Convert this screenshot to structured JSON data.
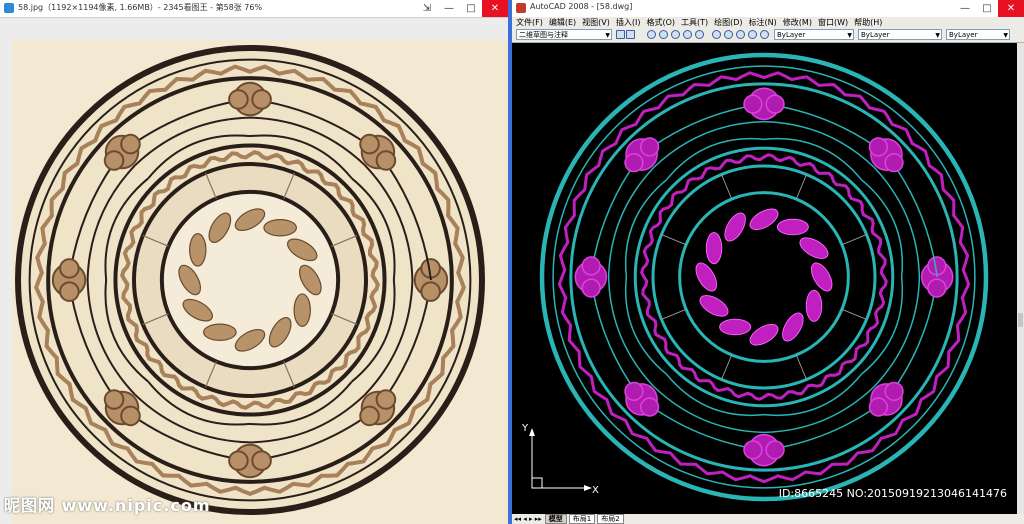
{
  "left_window": {
    "title": "58.jpg（1192×1194像素, 1.66MB）- 2345看图王 - 第58张 76%",
    "buttons": {
      "pin": "⇲",
      "min": "—",
      "max": "□",
      "close": "✕"
    },
    "watermark": "昵图网 www.nipic.com"
  },
  "right_window": {
    "title": "AutoCAD 2008 - [58.dwg]",
    "buttons": {
      "min": "—",
      "max": "□",
      "close": "✕"
    },
    "menu": [
      "文件(F)",
      "编辑(E)",
      "视图(V)",
      "插入(I)",
      "格式(O)",
      "工具(T)",
      "绘图(D)",
      "标注(N)",
      "修改(M)",
      "窗口(W)",
      "帮助(H)"
    ],
    "workspace_combo": "二维草图与注释",
    "color_combo": "ByLayer",
    "linetype_combo": "ByLayer",
    "lineweight_combo": "ByLayer",
    "ucs": {
      "x": "X",
      "y": "Y"
    },
    "tabs": [
      "模型",
      "布局1",
      "布局2"
    ],
    "id_text": "ID:8665245 NO:20150919213046141476"
  },
  "colors": {
    "cad_bg": "#000000",
    "cad_cyan": "#2ab4b4",
    "cad_magenta": "#c020c0",
    "marble_bg": "#f3e9d2",
    "marble_dark": "#2a1f18",
    "marble_brown": "#a8805a",
    "titlebar_accent": "#3c6fd8"
  }
}
